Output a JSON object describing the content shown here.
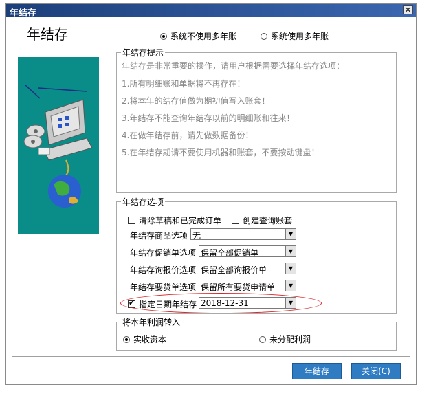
{
  "window": {
    "title": "年结存",
    "close_glyph": "✕"
  },
  "heading": "年结存",
  "mode": {
    "options": [
      {
        "label": "系统不使用多年账",
        "selected": true
      },
      {
        "label": "系统使用多年账",
        "selected": false
      }
    ]
  },
  "tips": {
    "legend": "年结存提示",
    "intro": "年结存是非常重要的操作，请用户根据需要选择年结存选项：",
    "lines": [
      "1.所有明细账和单据将不再存在！",
      "2.将本年的结存值做为期初值写入账套！",
      "3.年结存不能查询年结存以前的明细账和往来！",
      "4.在做年结存前，请先做数据备份！",
      "5.在年结存期请不要使用机器和账套，不要按动键盘！"
    ]
  },
  "options": {
    "legend": "年结存选项",
    "clear_drafts": {
      "label": "清除草稿和已完成订单",
      "checked": false
    },
    "create_query": {
      "label": "创建查询账套",
      "checked": false
    },
    "goods": {
      "label": "年结存商品选项",
      "value": "无"
    },
    "promo": {
      "label": "年结存促销单选项",
      "value": "保留全部促销单"
    },
    "quote": {
      "label": "年结存询报价选项",
      "value": "保留全部询报价单"
    },
    "requisition": {
      "label": "年结存要货单选项",
      "value": "保留所有要货申请单"
    },
    "date": {
      "label": "指定日期年结存",
      "checked": true,
      "value": "2018-12-31"
    }
  },
  "profit": {
    "legend": "将本年利润转入",
    "options": [
      {
        "label": "实收资本",
        "selected": true
      },
      {
        "label": "未分配利润",
        "selected": false
      }
    ]
  },
  "buttons": {
    "ok": "年结存",
    "close": "关闭(C)"
  },
  "colors": {
    "titlebar": "#1c3f7a",
    "button": "#2f7cc2",
    "sidebar": "#0a8c88",
    "highlight": "#d8282a"
  }
}
